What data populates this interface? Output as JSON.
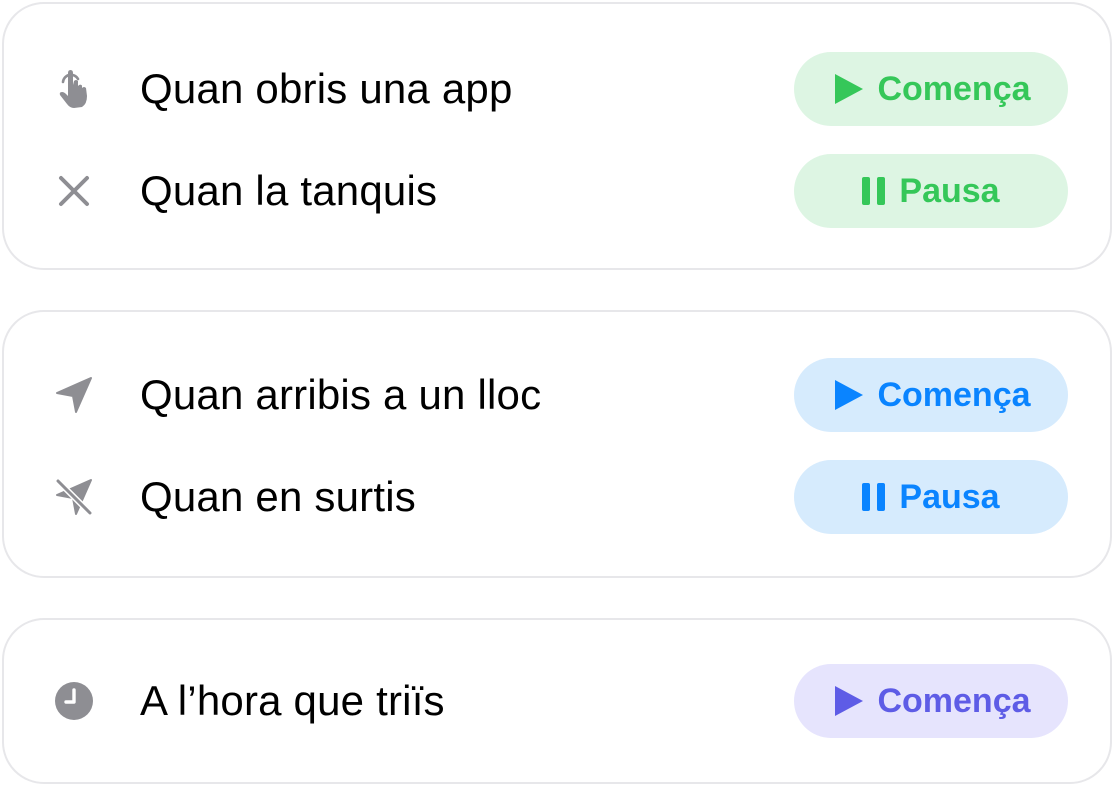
{
  "groups": [
    {
      "accent": "#35c759",
      "rows": [
        {
          "icon": "hand-tap-icon",
          "label": "Quan obris una app",
          "action": "Comença",
          "action_icon": "play-icon"
        },
        {
          "icon": "close-x-icon",
          "label": "Quan la tanquis",
          "action": "Pausa",
          "action_icon": "pause-icon"
        }
      ]
    },
    {
      "accent": "#0a84ff",
      "rows": [
        {
          "icon": "location-arrow-icon",
          "label": "Quan arribis a un lloc",
          "action": "Comença",
          "action_icon": "play-icon"
        },
        {
          "icon": "location-slash-icon",
          "label": "Quan en surtis",
          "action": "Pausa",
          "action_icon": "pause-icon"
        }
      ]
    },
    {
      "accent": "#5e5ce6",
      "rows": [
        {
          "icon": "clock-icon",
          "label": "A l’hora que triïs",
          "action": "Comença",
          "action_icon": "play-icon"
        }
      ]
    }
  ]
}
